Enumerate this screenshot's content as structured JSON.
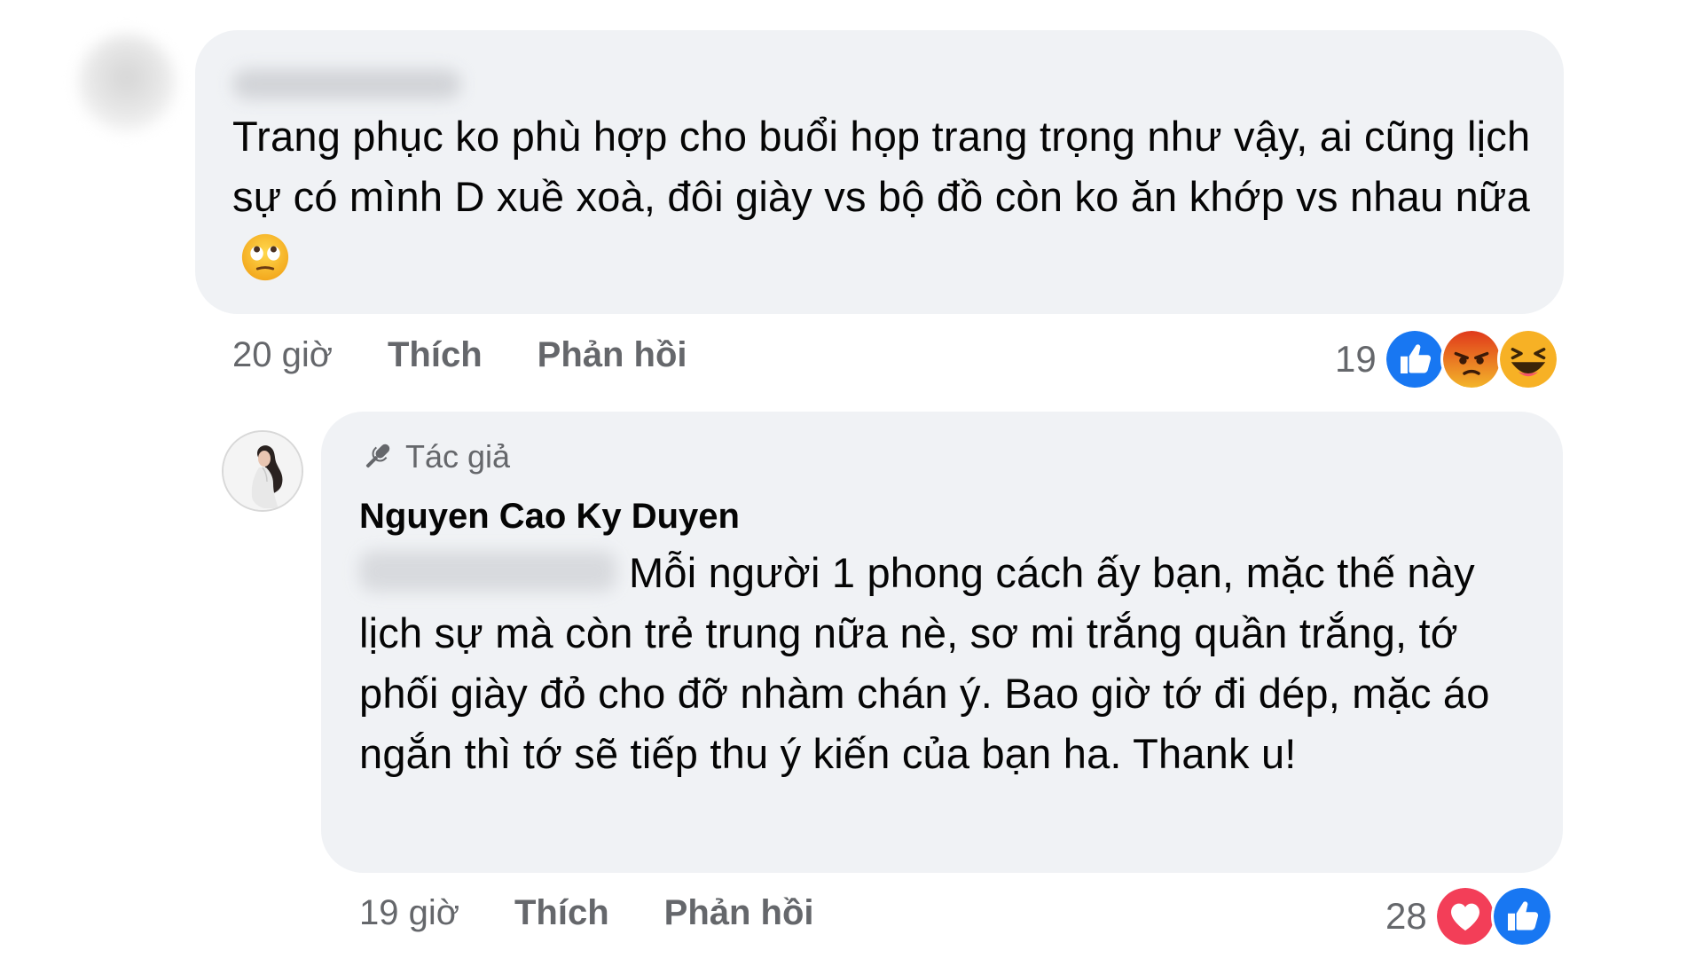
{
  "comment": {
    "text": "Trang phục ko phù hợp cho buổi họp trang trọng như vậy, ai cũng lịch sự có mình D xuề xoà, đôi giày vs bộ đồ còn ko ăn khớp vs nhau nữa",
    "emoji": "rolling-eyes-emoji",
    "time": "20 giờ",
    "like_label": "Thích",
    "reply_label": "Phản hồi",
    "reaction_count": "19",
    "reactions": [
      "like-icon",
      "angry-icon",
      "haha-icon"
    ]
  },
  "reply": {
    "badge": "Tác giả",
    "author": "Nguyen Cao Ky Duyen",
    "text": "Mỗi người 1 phong cách ấy bạn, mặc thế này lịch sự mà còn trẻ trung nữa nè, sơ mi trắng quần trắng, tớ phối giày đỏ cho đỡ nhàm chán ý. Bao giờ tớ đi dép, mặc áo ngắn thì tớ sẽ tiếp thu ý kiến của bạn ha. Thank u!",
    "time": "19 giờ",
    "like_label": "Thích",
    "reply_label": "Phản hồi",
    "reaction_count": "28",
    "reactions": [
      "love-icon",
      "like-icon"
    ]
  },
  "colors": {
    "bubble": "#f0f2f5",
    "meta_text": "#65676b",
    "like_blue": "#1877f2",
    "love_red": "#f33e58",
    "angry_orange": "#e9710f",
    "haha_yellow": "#f7b125"
  }
}
